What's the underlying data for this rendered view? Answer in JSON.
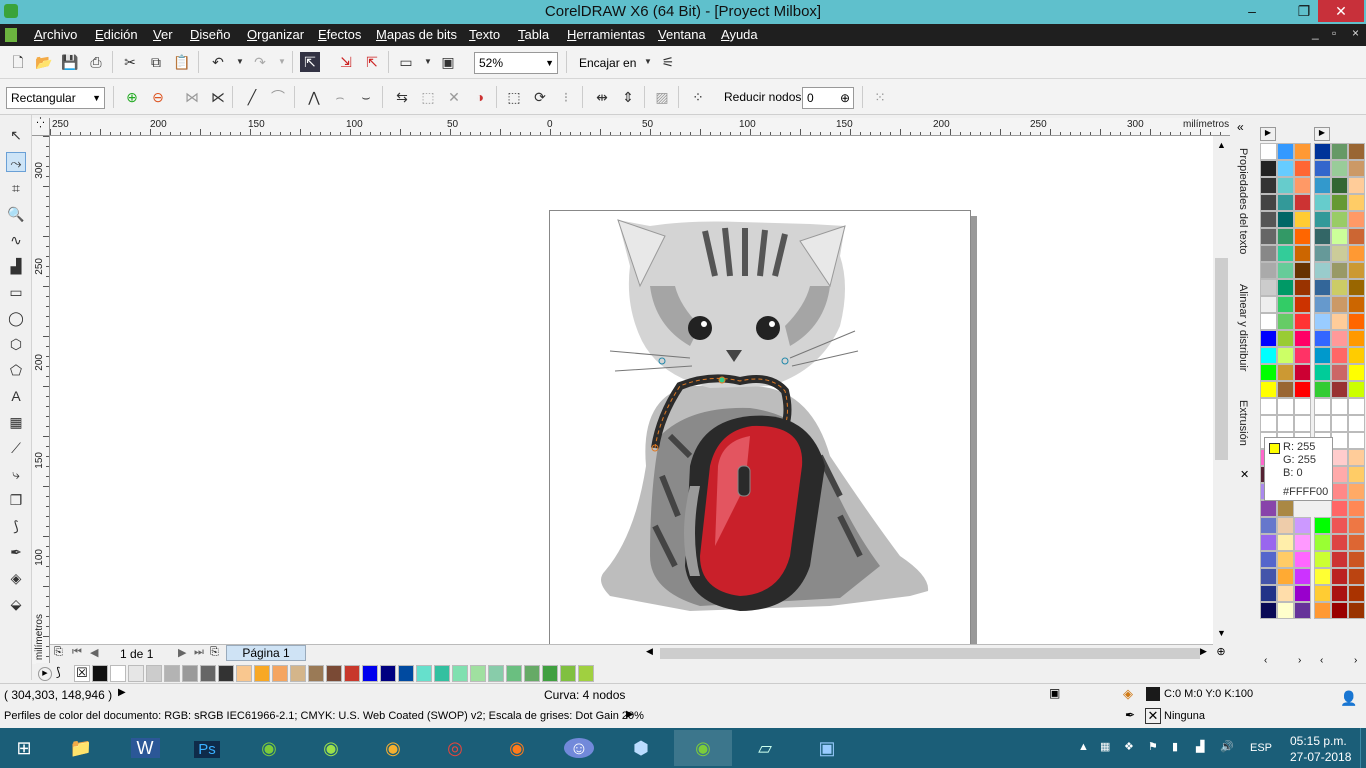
{
  "window": {
    "title": "CorelDRAW X6 (64 Bit) - [Proyect Milbox]",
    "minimize": "–",
    "restore": "❐",
    "close": "✕"
  },
  "menu": [
    "Archivo",
    "Edición",
    "Ver",
    "Diseño",
    "Organizar",
    "Efectos",
    "Mapas de bits",
    "Texto",
    "Tabla",
    "Herramientas",
    "Ventana",
    "Ayuda"
  ],
  "mdi_controls": [
    "_",
    "▫",
    "×"
  ],
  "toolbar1": {
    "zoom": "52%",
    "snap_label": "Encajar en"
  },
  "toolbar2": {
    "shape_type": "Rectangular",
    "reduce_nodes_label": "Reducir nodos",
    "reduce_nodes_value": "0"
  },
  "ruler": {
    "units": "milímetros",
    "h_labels": [
      "250",
      "200",
      "150",
      "100",
      "50",
      "0",
      "50",
      "100",
      "150",
      "200",
      "250",
      "300"
    ],
    "v_labels": [
      "300",
      "250",
      "200",
      "150",
      "100"
    ]
  },
  "page_nav": {
    "counter": "1 de 1",
    "tab": "Página 1"
  },
  "status": {
    "cursor": "( 304,303, 148,946 )",
    "selection": "Curva: 4 nodos",
    "fill": "C:0 M:0 Y:0 K:100",
    "outline": "Ninguna",
    "color_profiles": "Perfiles de color del documento: RGB: sRGB IEC61966-2.1; CMYK: U.S. Web Coated (SWOP) v2; Escala de grises: Dot Gain 20%"
  },
  "dockers": {
    "text_props": "Propiedades del texto",
    "align": "Alinear y distribuir",
    "extrusion": "Extrusión"
  },
  "tooltip": {
    "r": "R: 255",
    "g": "G: 255",
    "b": "B: 0",
    "hex": "#FFFF00"
  },
  "taskbar": {
    "lang": "ESP",
    "time": "05:15 p.m.",
    "date": "27-07-2018"
  },
  "colors": {
    "titlebar": "#5fc0cc",
    "menubar": "#1f1f1f",
    "taskbar": "#1b5e78",
    "close": "#c8303a"
  }
}
